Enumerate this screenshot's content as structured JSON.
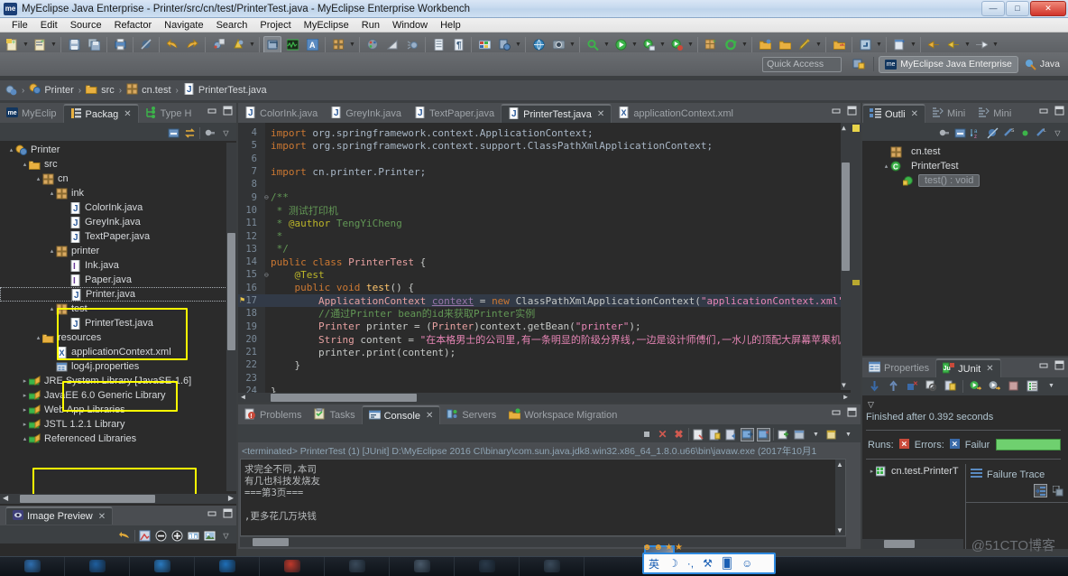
{
  "window": {
    "title": "MyEclipse Java Enterprise - Printer/src/cn/test/PrinterTest.java - MyEclipse Enterprise Workbench",
    "logo_text": "me",
    "minimize": "—",
    "maximize": "□",
    "close": "✕"
  },
  "menu": [
    "File",
    "Edit",
    "Source",
    "Refactor",
    "Navigate",
    "Search",
    "Project",
    "MyEclipse",
    "Run",
    "Window",
    "Help"
  ],
  "perspective": {
    "quick_access_placeholder": "Quick Access",
    "active_label": "MyEclipse Java Enterprise",
    "active_badge": "me",
    "other_label": "Java"
  },
  "breadcrumb": [
    {
      "label": "Printer",
      "icon": "project-icon"
    },
    {
      "label": "src",
      "icon": "source-folder-icon"
    },
    {
      "label": "cn.test",
      "icon": "package-icon"
    },
    {
      "label": "PrinterTest.java",
      "icon": "java-file-icon"
    }
  ],
  "explorer": {
    "tabs": [
      {
        "label": "MyEclip",
        "icon": "myeclipse-icon",
        "active": false
      },
      {
        "label": "Packag",
        "icon": "package-explorer-icon",
        "active": true,
        "closable": true
      },
      {
        "label": "Type H",
        "icon": "type-hierarchy-icon",
        "active": false
      }
    ],
    "tree": [
      {
        "indent": 0,
        "label": "Printer",
        "icon": "project-icon",
        "arrow": "▴",
        "highlight": false
      },
      {
        "indent": 1,
        "label": "src",
        "icon": "source-folder-icon",
        "arrow": "▴",
        "highlight": false
      },
      {
        "indent": 2,
        "label": "cn",
        "icon": "package-icon",
        "arrow": "▴",
        "highlight": false
      },
      {
        "indent": 3,
        "label": "ink",
        "icon": "package-icon",
        "arrow": "▴",
        "highlight": true
      },
      {
        "indent": 4,
        "label": "ColorInk.java",
        "icon": "java-file-icon",
        "arrow": "",
        "highlight": true
      },
      {
        "indent": 4,
        "label": "GreyInk.java",
        "icon": "java-file-icon",
        "arrow": "",
        "highlight": true
      },
      {
        "indent": 4,
        "label": "TextPaper.java",
        "icon": "java-file-icon",
        "arrow": "",
        "highlight": true
      },
      {
        "indent": 3,
        "label": "printer",
        "icon": "package-icon",
        "arrow": "▴",
        "highlight": false
      },
      {
        "indent": 4,
        "label": "Ink.java",
        "icon": "java-interface-icon",
        "arrow": "",
        "highlight": true
      },
      {
        "indent": 4,
        "label": "Paper.java",
        "icon": "java-interface-icon",
        "arrow": "",
        "highlight": true
      },
      {
        "indent": 4,
        "label": "Printer.java",
        "icon": "java-file-icon",
        "arrow": "",
        "highlight": false,
        "selected": true
      },
      {
        "indent": 3,
        "label": "test",
        "icon": "package-icon",
        "arrow": "▴",
        "highlight": false
      },
      {
        "indent": 4,
        "label": "PrinterTest.java",
        "icon": "java-file-icon",
        "arrow": "",
        "highlight": false
      },
      {
        "indent": 2,
        "label": "resources",
        "icon": "source-folder-icon",
        "arrow": "▴",
        "highlight": true
      },
      {
        "indent": 3,
        "label": "applicationContext.xml",
        "icon": "xml-file-icon",
        "arrow": "",
        "highlight": true
      },
      {
        "indent": 3,
        "label": "log4j.properties",
        "icon": "properties-file-icon",
        "arrow": "",
        "highlight": true
      },
      {
        "indent": 1,
        "label": "JRE System Library [JavaSE-1.6]",
        "icon": "library-icon",
        "arrow": "▸",
        "highlight": false
      },
      {
        "indent": 1,
        "label": "JavaEE 6.0 Generic Library",
        "icon": "library-icon",
        "arrow": "▸",
        "highlight": false
      },
      {
        "indent": 1,
        "label": "Web App Libraries",
        "icon": "library-icon",
        "arrow": "▸",
        "highlight": false
      },
      {
        "indent": 1,
        "label": "JSTL 1.2.1 Library",
        "icon": "library-icon",
        "arrow": "▸",
        "highlight": false
      },
      {
        "indent": 1,
        "label": "Referenced Libraries",
        "icon": "library-icon",
        "arrow": "▴",
        "highlight": false
      }
    ]
  },
  "image_preview": {
    "tab_label": "Image Preview",
    "close": "✕"
  },
  "editor": {
    "tabs": [
      {
        "label": "ColorInk.java",
        "icon": "java-file-icon",
        "active": false
      },
      {
        "label": "GreyInk.java",
        "icon": "java-file-icon",
        "active": false
      },
      {
        "label": "TextPaper.java",
        "icon": "java-file-icon",
        "active": false
      },
      {
        "label": "PrinterTest.java",
        "icon": "java-file-icon",
        "active": true,
        "closable": true
      },
      {
        "label": "applicationContext.xml",
        "icon": "xml-file-icon",
        "active": false
      }
    ],
    "lines": [
      {
        "num": "4",
        "tokens": [
          {
            "t": "import ",
            "c": "kw"
          },
          {
            "t": "org.springframework.context.ApplicationContext;",
            "c": "pkgc"
          }
        ]
      },
      {
        "num": "5",
        "tokens": [
          {
            "t": "import ",
            "c": "kw"
          },
          {
            "t": "org.springframework.context.support.ClassPathXmlApplicationContext;",
            "c": "pkgc"
          }
        ]
      },
      {
        "num": "6",
        "tokens": []
      },
      {
        "num": "7",
        "tokens": [
          {
            "t": "import ",
            "c": "kw"
          },
          {
            "t": "cn.printer.Printer;",
            "c": "pkgc"
          }
        ]
      },
      {
        "num": "8",
        "tokens": []
      },
      {
        "num": "9",
        "tokens": [
          {
            "t": "/**",
            "c": "jdoc"
          }
        ],
        "fold": true
      },
      {
        "num": "10",
        "tokens": [
          {
            "t": " * ",
            "c": "jdoc"
          },
          {
            "t": "测试打印机",
            "c": "jdoc"
          }
        ]
      },
      {
        "num": "11",
        "tokens": [
          {
            "t": " * ",
            "c": "jdoc"
          },
          {
            "t": "@author",
            "c": "anno"
          },
          {
            "t": " TengYiCheng",
            "c": "jdoc"
          }
        ]
      },
      {
        "num": "12",
        "tokens": [
          {
            "t": " *",
            "c": "jdoc"
          }
        ]
      },
      {
        "num": "13",
        "tokens": [
          {
            "t": " */",
            "c": "jdoc"
          }
        ]
      },
      {
        "num": "14",
        "tokens": [
          {
            "t": "public class ",
            "c": "kw"
          },
          {
            "t": "PrinterTest",
            "c": "typ"
          },
          {
            "t": " {",
            "c": "plain"
          }
        ]
      },
      {
        "num": "15",
        "tokens": [
          {
            "t": "    ",
            "c": "plain"
          },
          {
            "t": "@Test",
            "c": "anno"
          }
        ],
        "fold": true
      },
      {
        "num": "16",
        "tokens": [
          {
            "t": "    ",
            "c": "plain"
          },
          {
            "t": "public void ",
            "c": "kw"
          },
          {
            "t": "test",
            "c": "meth"
          },
          {
            "t": "() {",
            "c": "plain"
          }
        ]
      },
      {
        "num": "17",
        "tokens": [
          {
            "t": "        ",
            "c": "plain"
          },
          {
            "t": "ApplicationContext ",
            "c": "typ"
          },
          {
            "t": "context",
            "c": "fldu"
          },
          {
            "t": " = ",
            "c": "plain"
          },
          {
            "t": "new ",
            "c": "kw"
          },
          {
            "t": "ClassPathXmlApplicationContext(",
            "c": "plain"
          },
          {
            "t": "\"applicationContext.xml\"",
            "c": "str"
          },
          {
            "t": ");",
            "c": "plain"
          }
        ],
        "current": true,
        "bookmark": true
      },
      {
        "num": "18",
        "tokens": [
          {
            "t": "        ",
            "c": "plain"
          },
          {
            "t": "//通过Printer bean的id来获取Printer实例",
            "c": "cmt"
          }
        ]
      },
      {
        "num": "19",
        "tokens": [
          {
            "t": "        ",
            "c": "plain"
          },
          {
            "t": "Printer ",
            "c": "typ"
          },
          {
            "t": "printer",
            "c": "plain"
          },
          {
            "t": " = (",
            "c": "plain"
          },
          {
            "t": "Printer",
            "c": "typ"
          },
          {
            "t": ")context.getBean(",
            "c": "plain"
          },
          {
            "t": "\"printer\"",
            "c": "str"
          },
          {
            "t": ");",
            "c": "plain"
          }
        ]
      },
      {
        "num": "20",
        "tokens": [
          {
            "t": "        ",
            "c": "plain"
          },
          {
            "t": "String ",
            "c": "typ"
          },
          {
            "t": "content",
            "c": "plain"
          },
          {
            "t": " = ",
            "c": "plain"
          },
          {
            "t": "\"在本格男士的公司里,有一条明显的阶级分界线,一边是设计师傅们,一水儿的顶配大屏幕苹果机,另外零零星星几台顶配苹果笔记本另",
            "c": "str"
          }
        ]
      },
      {
        "num": "21",
        "tokens": [
          {
            "t": "        ",
            "c": "plain"
          },
          {
            "t": "printer.print(content);",
            "c": "plain"
          }
        ]
      },
      {
        "num": "22",
        "tokens": [
          {
            "t": "    }",
            "c": "plain"
          }
        ]
      },
      {
        "num": "23",
        "tokens": []
      },
      {
        "num": "24",
        "tokens": [
          {
            "t": "}",
            "c": "plain"
          }
        ]
      }
    ]
  },
  "outline": {
    "tabs": [
      {
        "label": "Outli",
        "icon": "outline-icon",
        "active": true,
        "closable": true
      },
      {
        "label": "Mini",
        "icon": "minimap-icon",
        "active": false
      },
      {
        "label": "Mini",
        "icon": "minimap-icon",
        "active": false
      }
    ],
    "items": [
      {
        "indent": 1,
        "label": "cn.test",
        "icon": "package-icon",
        "arrow": ""
      },
      {
        "indent": 1,
        "label": "PrinterTest",
        "icon": "class-icon",
        "arrow": "▴"
      },
      {
        "indent": 2,
        "label": "test() : void",
        "icon": "method-icon",
        "arrow": "",
        "selected": true
      }
    ]
  },
  "bottom_panel": {
    "tabs": [
      {
        "label": "Problems",
        "icon": "problems-icon",
        "active": false
      },
      {
        "label": "Tasks",
        "icon": "tasks-icon",
        "active": false
      },
      {
        "label": "Console",
        "icon": "console-icon",
        "active": true,
        "closable": true
      },
      {
        "label": "Servers",
        "icon": "servers-icon",
        "active": false
      },
      {
        "label": "Workspace Migration",
        "icon": "migration-icon",
        "active": false
      }
    ],
    "console_header": "<terminated> PrinterTest (1) [JUnit] D:\\MyEclipse 2016 CI\\binary\\com.sun.java.jdk8.win32.x86_64_1.8.0.u66\\bin\\javaw.exe (2017年10月1",
    "console_lines": [
      "求完全不同,本司",
      "有几也科技发烧友",
      "===第3页===",
      "",
      ",更多花几万块钱"
    ]
  },
  "junit": {
    "tabs": [
      {
        "label": "Properties",
        "icon": "properties-icon",
        "active": false
      },
      {
        "label": "JUnit",
        "icon": "junit-icon",
        "active": true,
        "closable": true
      }
    ],
    "status": "Finished after 0.392 seconds",
    "runs_label": "Runs:",
    "errors_label": "Errors:",
    "failures_label": "Failur",
    "bar_color": "#6fd06f",
    "tree_item": "cn.test.PrinterT",
    "failure_trace_label": "Failure Trace"
  },
  "watermark": "@51CTO博客",
  "ime": {
    "mode": "英",
    "icons": [
      "moon-icon",
      "punctuation-icon",
      "tool-icon",
      "keyboard-icon",
      "smiley-icon"
    ],
    "stars": [
      "★",
      "★"
    ]
  }
}
